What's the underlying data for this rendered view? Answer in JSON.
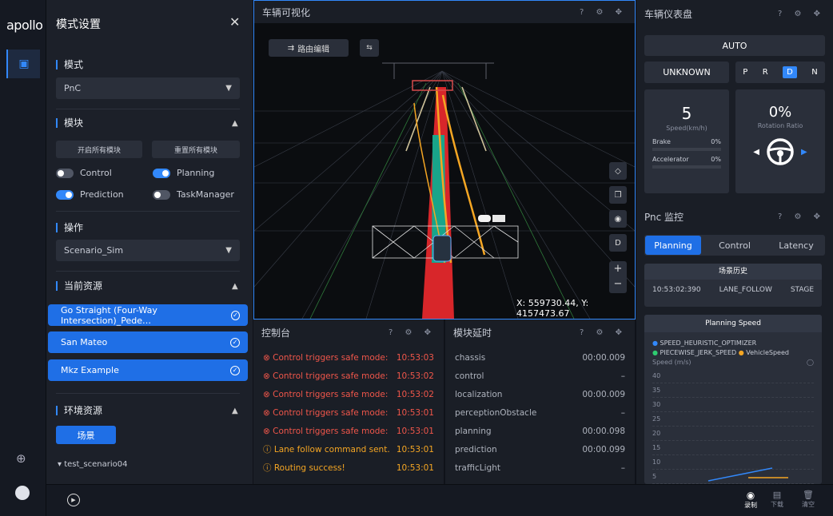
{
  "logo": "apollo",
  "panel": {
    "title": "模式设置",
    "mode_section": "模式",
    "mode_value": "PnC",
    "module_section": "模块",
    "enable_all": "开启所有模块",
    "reset_all": "重置所有模块",
    "modules": [
      {
        "label": "Control",
        "on": false
      },
      {
        "label": "Planning",
        "on": true
      },
      {
        "label": "Prediction",
        "on": true
      },
      {
        "label": "TaskManager",
        "on": false
      }
    ],
    "operation_section": "操作",
    "operation_value": "Scenario_Sim",
    "resource_section": "当前资源",
    "resources": [
      "Go Straight (Four-Way Intersection)_Pede…",
      "San Mateo",
      "Mkz Example"
    ],
    "env_section": "环境资源",
    "scene_button": "场景",
    "scenario_item": "test_scenario04"
  },
  "viz": {
    "title": "车辆可视化",
    "route_edit": "路由编辑",
    "coords": "X: 559730.44, Y: 4157473.67",
    "side_buttons": [
      "D"
    ]
  },
  "console": {
    "title": "控制台",
    "rows": [
      {
        "msg": "Control triggers safe mode:",
        "time": "10:53:03",
        "level": "error"
      },
      {
        "msg": "Control triggers safe mode:",
        "time": "10:53:02",
        "level": "error"
      },
      {
        "msg": "Control triggers safe mode:",
        "time": "10:53:02",
        "level": "error"
      },
      {
        "msg": "Control triggers safe mode:",
        "time": "10:53:01",
        "level": "error"
      },
      {
        "msg": "Control triggers safe mode:",
        "time": "10:53:01",
        "level": "error"
      },
      {
        "msg": "Lane follow command sent.",
        "time": "10:53:01",
        "level": "warn"
      },
      {
        "msg": "Routing success!",
        "time": "10:53:01",
        "level": "warn"
      }
    ]
  },
  "latency": {
    "title": "模块延时",
    "rows": [
      {
        "name": "chassis",
        "value": "00:00.009"
      },
      {
        "name": "control",
        "value": "–"
      },
      {
        "name": "localization",
        "value": "00:00.009"
      },
      {
        "name": "perceptionObstacle",
        "value": "–"
      },
      {
        "name": "planning",
        "value": "00:00.098"
      },
      {
        "name": "prediction",
        "value": "00:00.099"
      },
      {
        "name": "trafficLight",
        "value": "–"
      }
    ]
  },
  "dash": {
    "title": "车辆仪表盘",
    "mode": "AUTO",
    "status": "UNKNOWN",
    "gears": [
      "P",
      "R",
      "D",
      "N"
    ],
    "active_gear": "D",
    "speed": "5",
    "speed_label": "Speed(km/h)",
    "brake_label": "Brake",
    "brake_value": "0%",
    "accel_label": "Accelerator",
    "accel_value": "0%",
    "rotation": "0%",
    "rotation_label": "Rotation Ratio"
  },
  "pnc": {
    "title": "Pnc 监控",
    "tabs": [
      "Planning",
      "Control",
      "Latency"
    ],
    "history_title": "场景历史",
    "history_time": "10:53:02:390",
    "history_scenario": "LANE_FOLLOW",
    "history_stage": "STAGE",
    "speed_title": "Planning Speed",
    "legend": [
      "SPEED_HEURISTIC_OPTIMIZER",
      "PIECEWISE_JERK_SPEED",
      "VehicleSpeed"
    ],
    "ylabel": "Speed (m/s)",
    "yticks": [
      "40",
      "35",
      "30",
      "25",
      "20",
      "15",
      "10",
      "5"
    ]
  },
  "bottom": {
    "record": "录制",
    "download": "下载",
    "clear": "清空"
  },
  "colors": {
    "accent": "#3288fa",
    "error": "#f0564a",
    "warn": "#f5a623"
  }
}
